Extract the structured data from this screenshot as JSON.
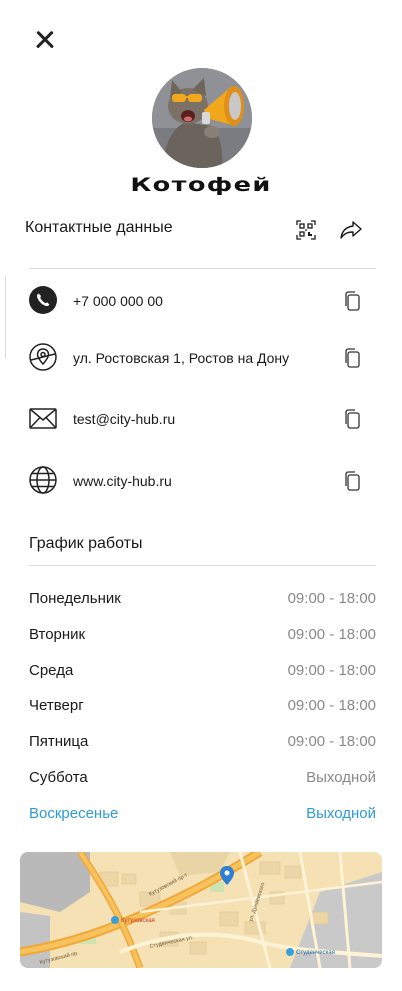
{
  "header": {
    "close_icon": "close-icon"
  },
  "profile": {
    "name": "Котофей"
  },
  "contacts": {
    "title": "Контактные данные",
    "actions": [
      "qr-code-icon",
      "share-icon"
    ],
    "items": [
      {
        "icon": "phone-icon",
        "text": "+7 000 000 00"
      },
      {
        "icon": "location-icon",
        "text": "ул. Ростовская 1,  Ростов на Дону"
      },
      {
        "icon": "mail-icon",
        "text": "test@city-hub.ru"
      },
      {
        "icon": "globe-icon",
        "text": "www.city-hub.ru"
      }
    ],
    "copy_icon": "copy-icon"
  },
  "schedule": {
    "title": "График работы",
    "rows": [
      {
        "day": "Понедельник",
        "hours": "09:00 - 18:00"
      },
      {
        "day": "Вторник",
        "hours": "09:00 - 18:00"
      },
      {
        "day": "Среда",
        "hours": "09:00 - 18:00"
      },
      {
        "day": "Четверг",
        "hours": "09:00 - 18:00"
      },
      {
        "day": "Пятница",
        "hours": "09:00 - 18:00"
      },
      {
        "day": "Суббота",
        "hours": "Выходной"
      },
      {
        "day": "Воскресенье",
        "hours": "Выходной"
      }
    ],
    "today_color": "#2f9ad6"
  },
  "map": {
    "labels": [
      "Кутузовская",
      "Кутузовский пр-т",
      "Студенческая ул.",
      "Кутузовский пр.",
      "Студенческая",
      "ул. Дунаевского"
    ]
  }
}
